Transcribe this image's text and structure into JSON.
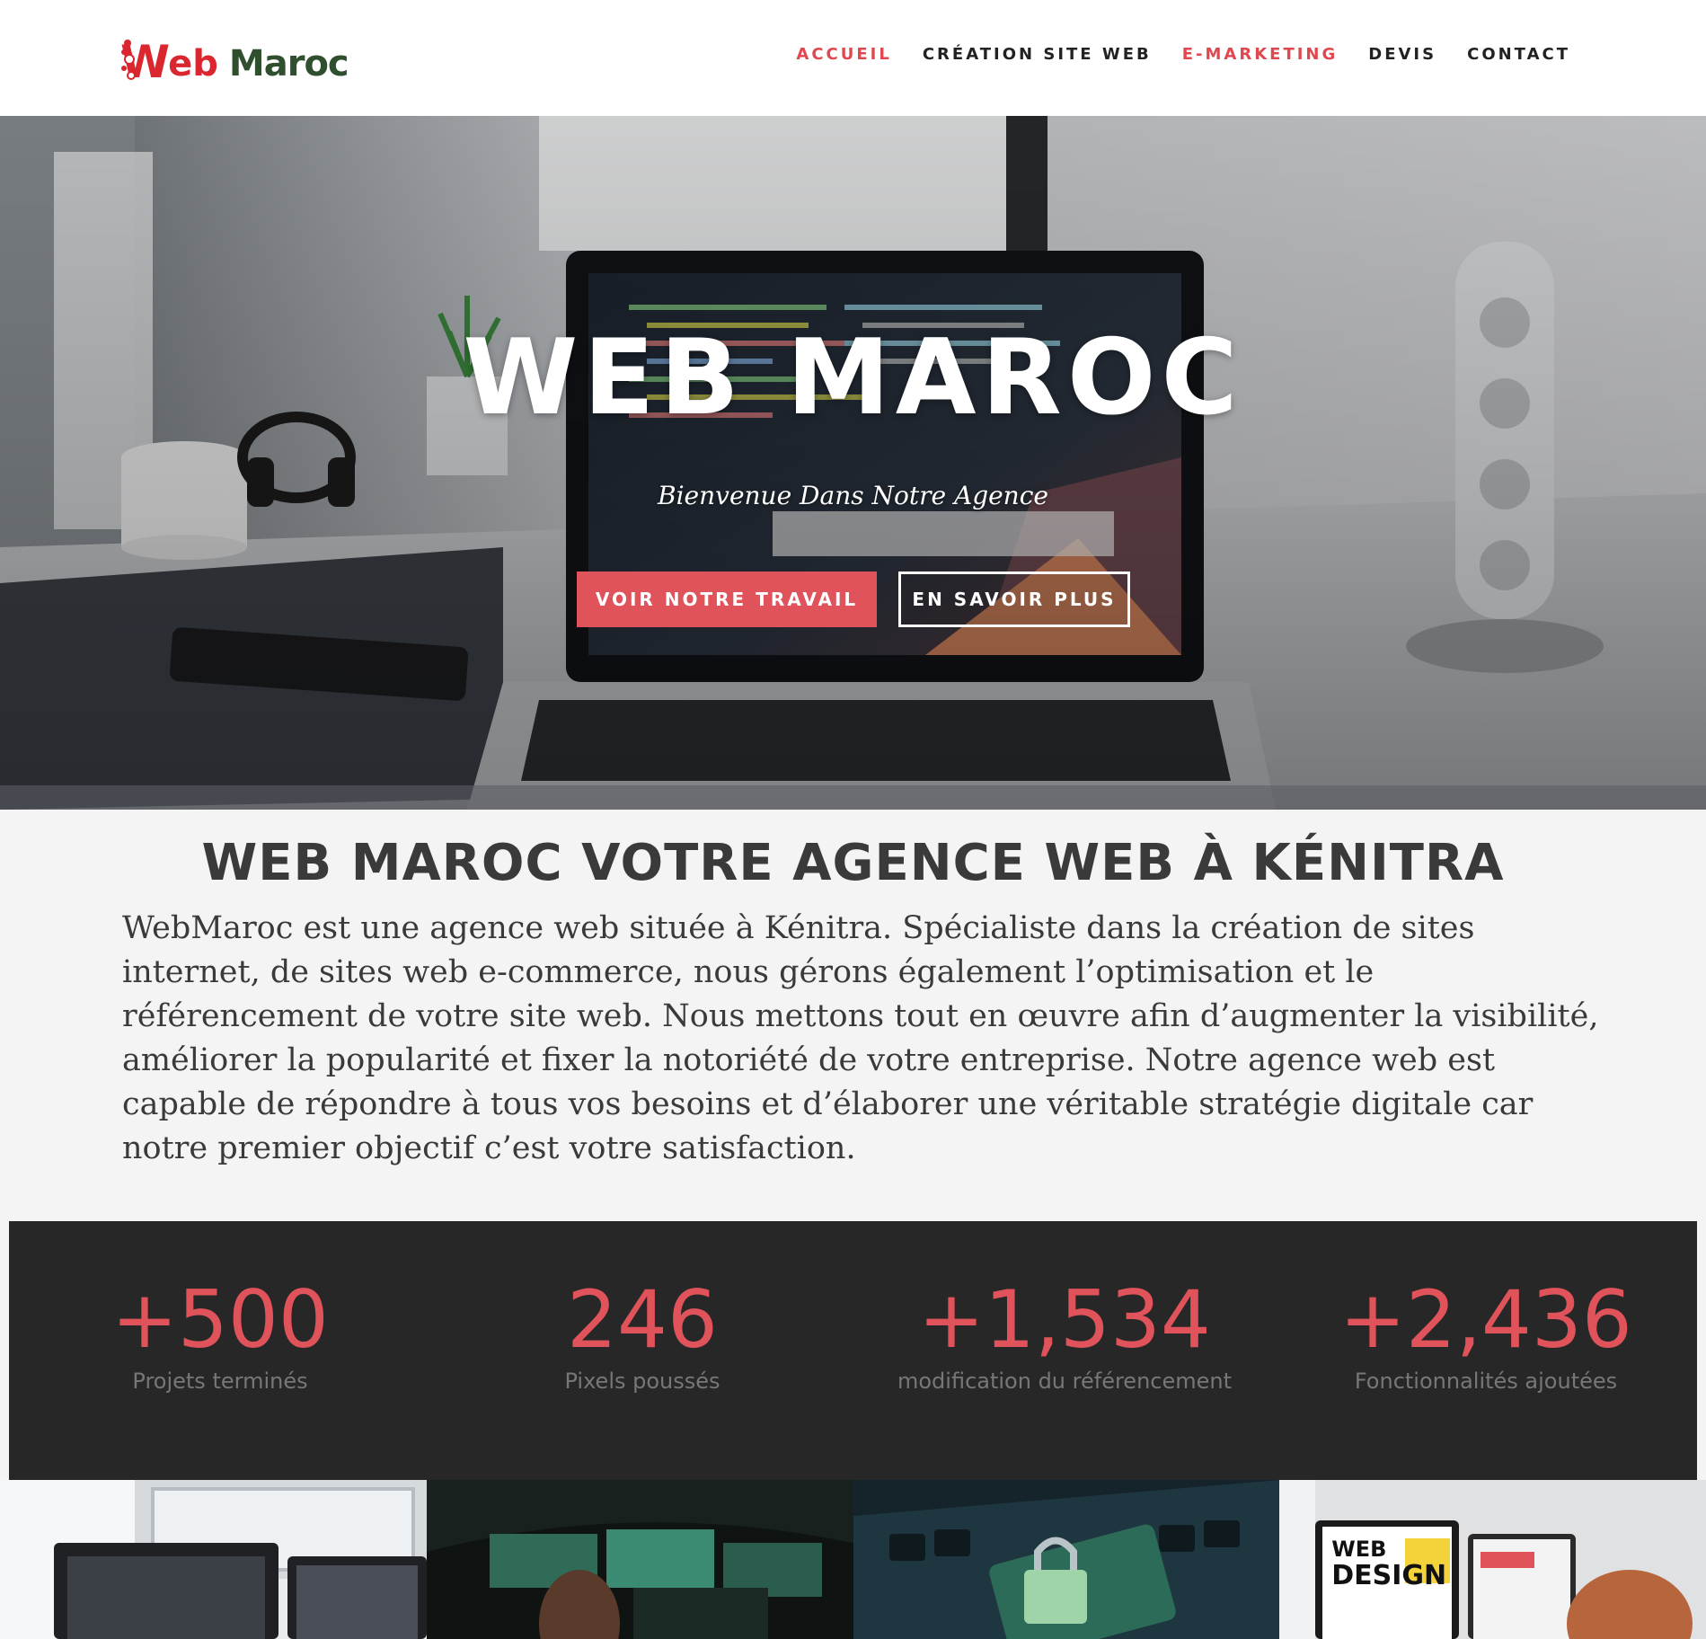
{
  "logo": {
    "letter": "W",
    "eb": "eb",
    "maroc": "Maroc"
  },
  "nav": [
    {
      "label": "ACCUEIL",
      "active": true
    },
    {
      "label": "CRÉATION SITE WEB",
      "active": false
    },
    {
      "label": "E-MARKETING",
      "active": true
    },
    {
      "label": "DEVIS",
      "active": false
    },
    {
      "label": "CONTACT",
      "active": false
    }
  ],
  "hero": {
    "title": "WEB MAROC",
    "subtitle": "Bienvenue Dans Notre Agence",
    "primary_button": "VOIR NOTRE TRAVAIL",
    "secondary_button": "EN SAVOIR PLUS"
  },
  "about": {
    "title": "WEB MAROC VOTRE AGENCE WEB À KÉNITRA",
    "text": "WebMaroc est une agence web située à Kénitra. Spécialiste dans la création de sites internet, de sites web e-commerce, nous gérons également l’optimisation et le référencement de votre site web. Nous mettons tout en œuvre afin d’augmenter la visibilité, améliorer la popularité et fixer la notoriété de votre entreprise. Notre agence web est capable de répondre à tous vos besoins et d’élaborer une véritable stratégie digitale car notre premier objectif c’est votre satisfaction."
  },
  "stats": [
    {
      "value": "+500",
      "label": "Projets terminés"
    },
    {
      "value": "246",
      "label": "Pixels poussés"
    },
    {
      "value": "+1,534",
      "label": "modification du référencement"
    },
    {
      "value": "+2,436",
      "label": "Fonctionnalités ajoutées"
    }
  ],
  "gallery": {
    "tile4_text_1": "WEB",
    "tile4_text_2": "DESIGN"
  },
  "colors": {
    "accent": "#e0535a",
    "logo_red": "#d9262f",
    "logo_green": "#2f4f2f",
    "stats_bg": "#272727"
  }
}
